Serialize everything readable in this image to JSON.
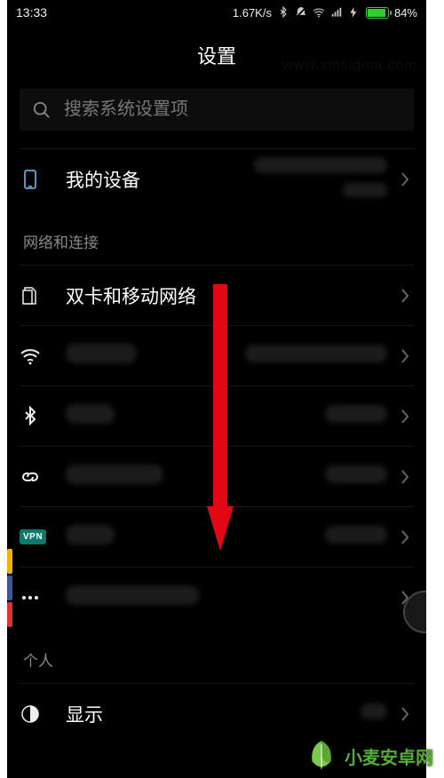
{
  "statusbar": {
    "time": "13:33",
    "net_speed": "1.67K/s",
    "battery_pct": "84%"
  },
  "title": "设置",
  "search": {
    "placeholder": "搜索系统设置项"
  },
  "rows": {
    "my_device": {
      "label": "我的设备"
    },
    "section_network": "网络和连接",
    "dual_sim": {
      "label": "双卡和移动网络"
    },
    "vpn_badge": "VPN",
    "section_personal": "个人",
    "display": {
      "label": "显示"
    }
  },
  "watermark": {
    "faint": "www.xmsigma.com",
    "logo_text": "小麦安卓网"
  },
  "colors": {
    "arrow": "#e30613",
    "battery": "#3c3",
    "vpn": "#0a7a6c",
    "logo": "#52b030"
  }
}
